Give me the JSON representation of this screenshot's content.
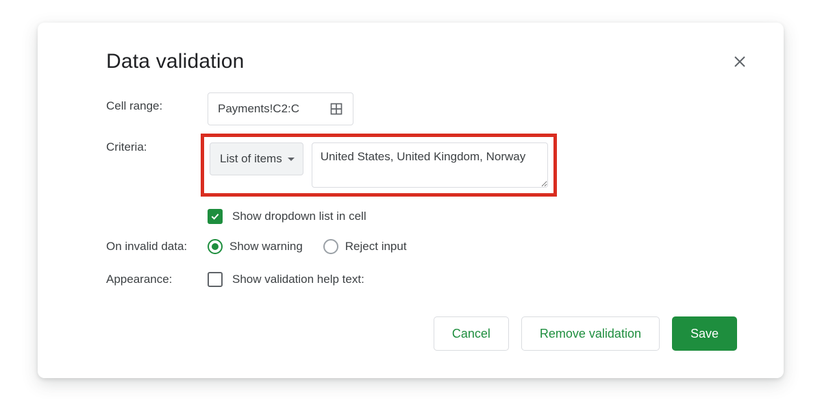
{
  "dialog": {
    "title": "Data validation"
  },
  "labels": {
    "cell_range": "Cell range:",
    "criteria": "Criteria:",
    "on_invalid": "On invalid data:",
    "appearance": "Appearance:"
  },
  "cell_range": {
    "value": "Payments!C2:C"
  },
  "criteria": {
    "type_label": "List of items",
    "items_value": "United States, United Kingdom, Norway"
  },
  "show_dropdown": {
    "label": "Show dropdown list in cell",
    "checked": true
  },
  "on_invalid": {
    "options": {
      "warn": "Show warning",
      "reject": "Reject input"
    },
    "selected": "warn"
  },
  "appearance": {
    "help_text_label": "Show validation help text:",
    "checked": false
  },
  "buttons": {
    "cancel": "Cancel",
    "remove": "Remove validation",
    "save": "Save"
  },
  "colors": {
    "accent": "#1e8e3e",
    "highlight_box": "#d92d20"
  }
}
